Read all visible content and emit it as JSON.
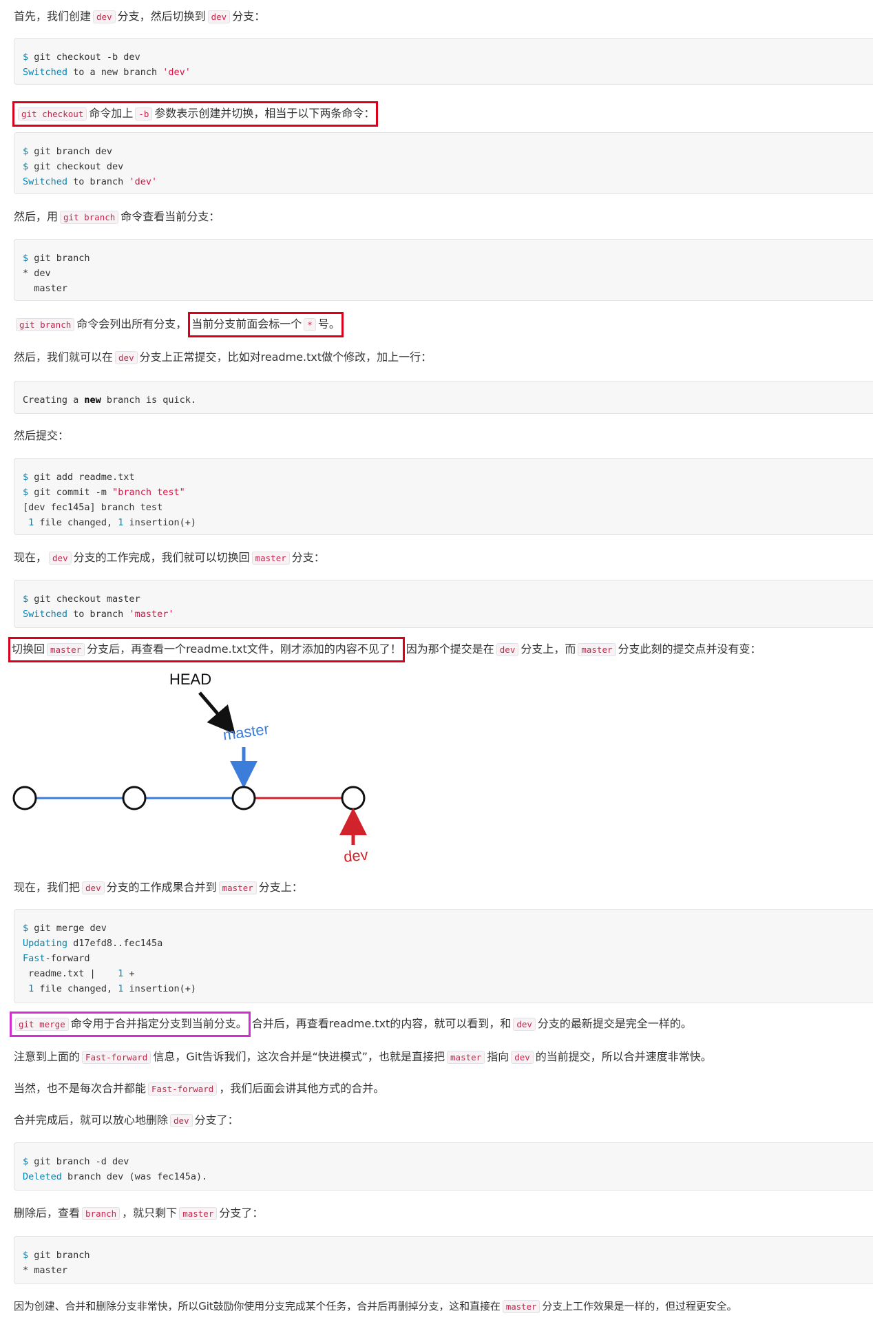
{
  "p1": {
    "t1": "首先，我们创建",
    "c1": "dev",
    "t2": "分支，然后切换到",
    "c2": "dev",
    "t3": "分支："
  },
  "b1": {
    "l1": "git checkout -b dev",
    "l2_a": "Switched",
    "l2_b": " to a new branch ",
    "l2_c": "'dev'"
  },
  "p2": {
    "c1": "git checkout",
    "t1": "命令加上",
    "c2": "-b",
    "t2": "参数表示创建并切换，相当于以下两条命令："
  },
  "b2": {
    "l1": "git branch dev",
    "l2": "git checkout dev",
    "l3_a": "Switched",
    "l3_b": " to branch ",
    "l3_c": "'dev'"
  },
  "p3": {
    "t1": "然后，用",
    "c1": "git branch",
    "t2": "命令查看当前分支："
  },
  "b3": {
    "l1": "git branch",
    "l2": "* dev",
    "l3": "  master"
  },
  "p4": {
    "c1": "git branch",
    "t1": "命令会列出所有分支，",
    "t2": "当前分支前面会标一个",
    "c2": "*",
    "t3": "号。"
  },
  "p5": {
    "t1": "然后，我们就可以在",
    "c1": "dev",
    "t2": "分支上正常提交，比如对readme.txt做个修改，加上一行："
  },
  "b4": {
    "l1_a": "Creating a ",
    "l1_b": "new",
    "l1_c": " branch is quick."
  },
  "p6": {
    "t1": "然后提交："
  },
  "b5": {
    "l1": "git add readme.txt",
    "l2_a": "git commit -m ",
    "l2_b": "\"branch test\"",
    "l3": "[dev fec145a] branch test",
    "l4_a": "1",
    "l4_b": " file changed, ",
    "l4_c": "1",
    "l4_d": " insertion(+)"
  },
  "p7": {
    "t1": "现在，",
    "c1": "dev",
    "t2": "分支的工作完成，我们就可以切换回",
    "c2": "master",
    "t3": "分支："
  },
  "b6": {
    "l1": "git checkout master",
    "l2_a": "Switched",
    "l2_b": " to branch ",
    "l2_c": "'master'"
  },
  "p8": {
    "t1": "切换回",
    "c1": "master",
    "t2": "分支后，再查看一个readme.txt文件，刚才添加的内容不见了！",
    "t3": "因为那个提交是在",
    "c2": "dev",
    "t4": "分支上，而",
    "c3": "master",
    "t5": "分支此刻的提交点并没有变："
  },
  "diagram": {
    "head_label": "HEAD",
    "master_label": "master",
    "dev_label": "dev",
    "blue": "#3b7dd8",
    "red": "#d0232b"
  },
  "p9": {
    "t1": "现在，我们把",
    "c1": "dev",
    "t2": "分支的工作成果合并到",
    "c2": "master",
    "t3": "分支上："
  },
  "b7": {
    "l1": "git merge dev",
    "l2_a": "Updating",
    "l2_b": " d17efd8..fec145a",
    "l3_a": "Fast",
    "l3_b": "-forward",
    "l4_a": " readme.txt |    ",
    "l4_b": "1",
    "l4_c": " +",
    "l5_a": "1",
    "l5_b": " file changed, ",
    "l5_c": "1",
    "l5_d": " insertion(+)"
  },
  "p10": {
    "c1": "git merge",
    "t1": "命令用于合并指定分支到当前分支。",
    "t2": "合并后，再查看readme.txt的内容，就可以看到，和",
    "c2": "dev",
    "t3": "分支的最新提交是完全一样的。"
  },
  "p11": {
    "t1": "注意到上面的",
    "c1": "Fast-forward",
    "t2": "信息，Git告诉我们，这次合并是“快进模式”，也就是直接把",
    "c2": "master",
    "t3": "指向",
    "c3": "dev",
    "t4": "的当前提交，所以合并速度非常快。"
  },
  "p12": {
    "t1": "当然，也不是每次合并都能",
    "c1": "Fast-forward",
    "t2": "，我们后面会讲其他方式的合并。"
  },
  "p13": {
    "t1": "合并完成后，就可以放心地删除",
    "c1": "dev",
    "t2": "分支了："
  },
  "b8": {
    "l1": "git branch -d dev",
    "l2_a": "Deleted",
    "l2_b": " branch dev (was fec145a)."
  },
  "p14": {
    "t1": "删除后，查看",
    "c1": "branch",
    "t2": "，就只剩下",
    "c2": "master",
    "t3": "分支了："
  },
  "b9": {
    "l1": "git branch",
    "l2": "* master"
  },
  "p15": {
    "t1": "因为创建、合并和删除分支非常快，所以Git鼓励你使用分支完成某个任务，合并后再删掉分支，这和直接在",
    "c1": "master",
    "t2": "分支上工作效果是一样的，但过程更安全。"
  }
}
